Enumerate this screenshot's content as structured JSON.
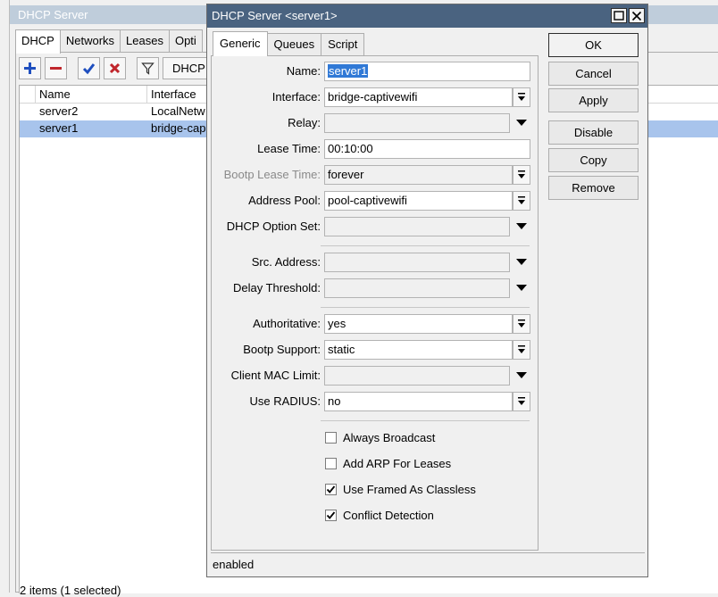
{
  "background_window": {
    "title": "DHCP Server",
    "tabs": [
      {
        "label": "DHCP",
        "active": true
      },
      {
        "label": "Networks",
        "active": false
      },
      {
        "label": "Leases",
        "active": false
      },
      {
        "label": "Opti",
        "active": false
      }
    ],
    "toolbar": {
      "add_icon": "plus-icon",
      "remove_icon": "minus-icon",
      "enable_icon": "check-icon",
      "disable_icon": "x-icon",
      "filter_icon": "filter-icon",
      "dhcp_config_label": "DHCP"
    },
    "list": {
      "columns": [
        "Name",
        "Interface"
      ],
      "rows": [
        {
          "name": "server2",
          "interface": "LocalNetw",
          "selected": false
        },
        {
          "name": "server1",
          "interface": "bridge-cap",
          "selected": true
        }
      ]
    },
    "status": "2 items (1 selected)"
  },
  "dialog": {
    "title": "DHCP Server <server1>",
    "tabs": [
      {
        "label": "Generic",
        "active": true
      },
      {
        "label": "Queues",
        "active": false
      },
      {
        "label": "Script",
        "active": false
      }
    ],
    "fields": {
      "name": {
        "label": "Name:",
        "value": "server1"
      },
      "interface": {
        "label": "Interface:",
        "value": "bridge-captivewifi"
      },
      "relay": {
        "label": "Relay:",
        "value": ""
      },
      "lease_time": {
        "label": "Lease Time:",
        "value": "00:10:00"
      },
      "bootp_lease_time": {
        "label": "Bootp Lease Time:",
        "value": "forever"
      },
      "address_pool": {
        "label": "Address Pool:",
        "value": "pool-captivewifi"
      },
      "dhcp_option_set": {
        "label": "DHCP Option Set:",
        "value": ""
      },
      "src_address": {
        "label": "Src. Address:",
        "value": ""
      },
      "delay_threshold": {
        "label": "Delay Threshold:",
        "value": ""
      },
      "authoritative": {
        "label": "Authoritative:",
        "value": "yes"
      },
      "bootp_support": {
        "label": "Bootp Support:",
        "value": "static"
      },
      "client_mac_limit": {
        "label": "Client MAC Limit:",
        "value": ""
      },
      "use_radius": {
        "label": "Use RADIUS:",
        "value": "no"
      }
    },
    "checkboxes": [
      {
        "label": "Always Broadcast",
        "checked": false
      },
      {
        "label": "Add ARP For Leases",
        "checked": false
      },
      {
        "label": "Use Framed As Classless",
        "checked": true
      },
      {
        "label": "Conflict Detection",
        "checked": true
      }
    ],
    "buttons": {
      "ok": "OK",
      "cancel": "Cancel",
      "apply": "Apply",
      "disable": "Disable",
      "copy": "Copy",
      "remove": "Remove"
    },
    "status": "enabled"
  },
  "colors": {
    "dialog_titlebar": "#4a6380",
    "bg_titlebar": "#bfcddb",
    "selection": "#a8c4ec",
    "text_selection": "#3079d6",
    "add_blue": "#1f4fbf",
    "remove_red": "#c0262c"
  }
}
